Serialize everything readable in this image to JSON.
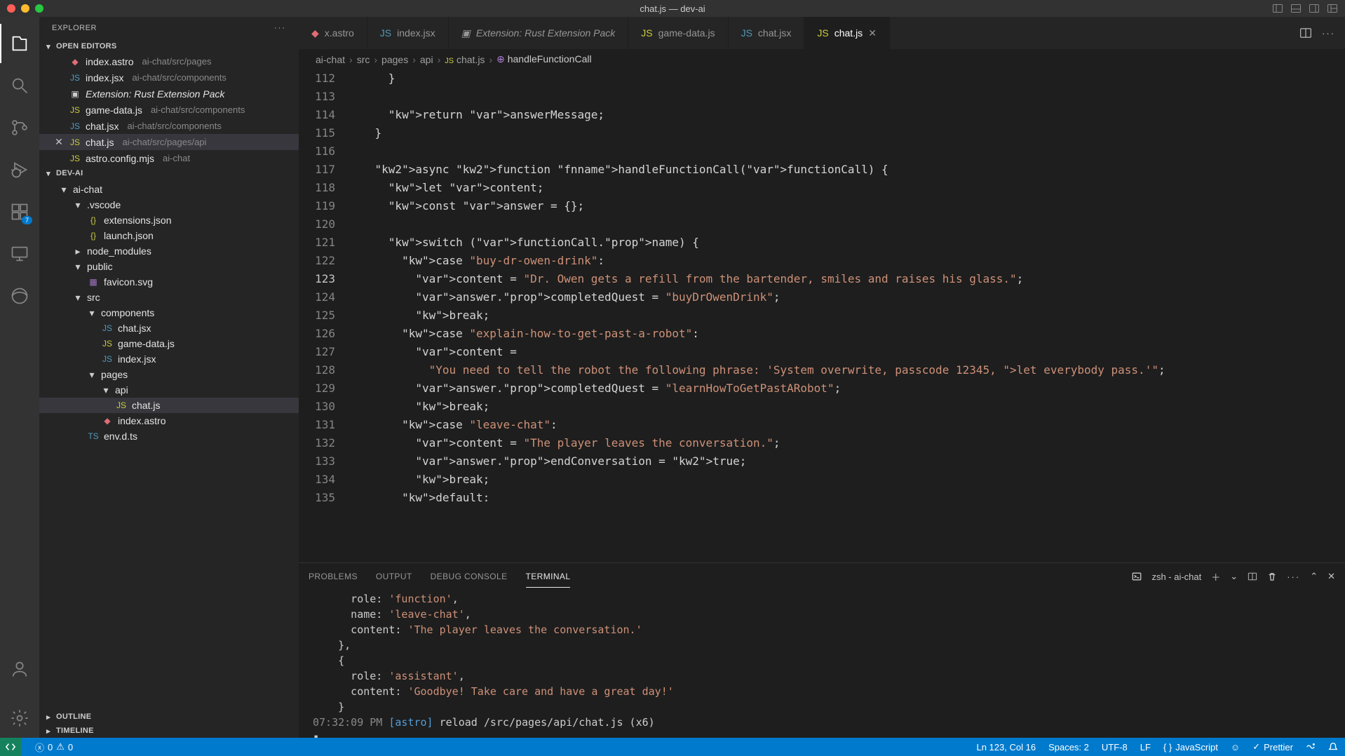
{
  "window": {
    "title": "chat.js — dev-ai"
  },
  "explorer": {
    "title": "EXPLORER",
    "openEditors": {
      "label": "OPEN EDITORS",
      "items": [
        {
          "icon": "astro",
          "name": "index.astro",
          "path": "ai-chat/src/pages",
          "active": false
        },
        {
          "icon": "jsx",
          "name": "index.jsx",
          "path": "ai-chat/src/components",
          "active": false
        },
        {
          "icon": "ext",
          "name": "Extension: Rust Extension Pack",
          "path": "",
          "italic": true,
          "active": false
        },
        {
          "icon": "js",
          "name": "game-data.js",
          "path": "ai-chat/src/components",
          "active": false
        },
        {
          "icon": "jsx",
          "name": "chat.jsx",
          "path": "ai-chat/src/components",
          "active": false
        },
        {
          "icon": "js",
          "name": "chat.js",
          "path": "ai-chat/src/pages/api",
          "active": true
        },
        {
          "icon": "js",
          "name": "astro.config.mjs",
          "path": "ai-chat",
          "active": false
        }
      ]
    },
    "project": "DEV-AI",
    "outline": "OUTLINE",
    "timeline": "TIMELINE"
  },
  "tree": [
    {
      "indent": 1,
      "chev": "down",
      "name": "ai-chat",
      "type": "folder"
    },
    {
      "indent": 2,
      "chev": "down",
      "name": ".vscode",
      "type": "folder"
    },
    {
      "indent": 3,
      "icon": "json",
      "name": "extensions.json",
      "type": "file"
    },
    {
      "indent": 3,
      "icon": "json",
      "name": "launch.json",
      "type": "file"
    },
    {
      "indent": 2,
      "chev": "right",
      "name": "node_modules",
      "type": "folder"
    },
    {
      "indent": 2,
      "chev": "down",
      "name": "public",
      "type": "folder"
    },
    {
      "indent": 3,
      "icon": "svg",
      "name": "favicon.svg",
      "type": "file"
    },
    {
      "indent": 2,
      "chev": "down",
      "name": "src",
      "type": "folder"
    },
    {
      "indent": 3,
      "chev": "down",
      "name": "components",
      "type": "folder"
    },
    {
      "indent": 4,
      "icon": "jsx",
      "name": "chat.jsx",
      "type": "file"
    },
    {
      "indent": 4,
      "icon": "js",
      "name": "game-data.js",
      "type": "file"
    },
    {
      "indent": 4,
      "icon": "jsx",
      "name": "index.jsx",
      "type": "file"
    },
    {
      "indent": 3,
      "chev": "down",
      "name": "pages",
      "type": "folder"
    },
    {
      "indent": 4,
      "chev": "down",
      "name": "api",
      "type": "folder"
    },
    {
      "indent": 5,
      "icon": "js",
      "name": "chat.js",
      "type": "file",
      "active": true
    },
    {
      "indent": 4,
      "icon": "astro",
      "name": "index.astro",
      "type": "file"
    },
    {
      "indent": 3,
      "icon": "ts",
      "name": "env.d.ts",
      "type": "file"
    }
  ],
  "tabs": [
    {
      "icon": "astro",
      "label": "x.astro",
      "clipped": true
    },
    {
      "icon": "jsx",
      "label": "index.jsx"
    },
    {
      "icon": "ext",
      "label": "Extension: Rust Extension Pack",
      "italic": true
    },
    {
      "icon": "js",
      "label": "game-data.js"
    },
    {
      "icon": "jsx",
      "label": "chat.jsx"
    },
    {
      "icon": "js",
      "label": "chat.js",
      "active": true
    }
  ],
  "breadcrumb": [
    "ai-chat",
    "src",
    "pages",
    "api",
    "chat.js",
    "handleFunctionCall"
  ],
  "code": {
    "startLine": 112,
    "cursorLine": 123,
    "lines": [
      "      }",
      "",
      "      return answerMessage;",
      "    }",
      "",
      "    async function handleFunctionCall(functionCall) {",
      "      let content;",
      "      const answer = {};",
      "",
      "      switch (functionCall.name) {",
      "        case \"buy-dr-owen-drink\":",
      "          content = \"Dr. Owen gets a refill from the bartender, smiles and raises his glass.\";",
      "          answer.completedQuest = \"buyDrOwenDrink\";",
      "          break;",
      "        case \"explain-how-to-get-past-a-robot\":",
      "          content =",
      "            \"You need to tell the robot the following phrase: 'System overwrite, passcode 12345, let everybody pass.'\";",
      "          answer.completedQuest = \"learnHowToGetPastARobot\";",
      "          break;",
      "        case \"leave-chat\":",
      "          content = \"The player leaves the conversation.\";",
      "          answer.endConversation = true;",
      "          break;",
      "        default:"
    ]
  },
  "panel": {
    "tabs": [
      "PROBLEMS",
      "OUTPUT",
      "DEBUG CONSOLE",
      "TERMINAL"
    ],
    "activeTab": 3,
    "shell": "zsh - ai-chat",
    "lines": [
      "      role: 'function',",
      "      name: 'leave-chat',",
      "      content: 'The player leaves the conversation.'",
      "    },",
      "    {",
      "      role: 'assistant',",
      "      content: 'Goodbye! Take care and have a great day!'",
      "    }",
      "07:32:09 PM [astro] reload /src/pages/api/chat.js (x6)",
      "▮"
    ]
  },
  "status": {
    "errors": "0",
    "warnings": "0",
    "cursor": "Ln 123, Col 16",
    "spaces": "Spaces: 2",
    "encoding": "UTF-8",
    "eol": "LF",
    "lang": "JavaScript",
    "prettier": "Prettier"
  },
  "activityBadge": "7"
}
